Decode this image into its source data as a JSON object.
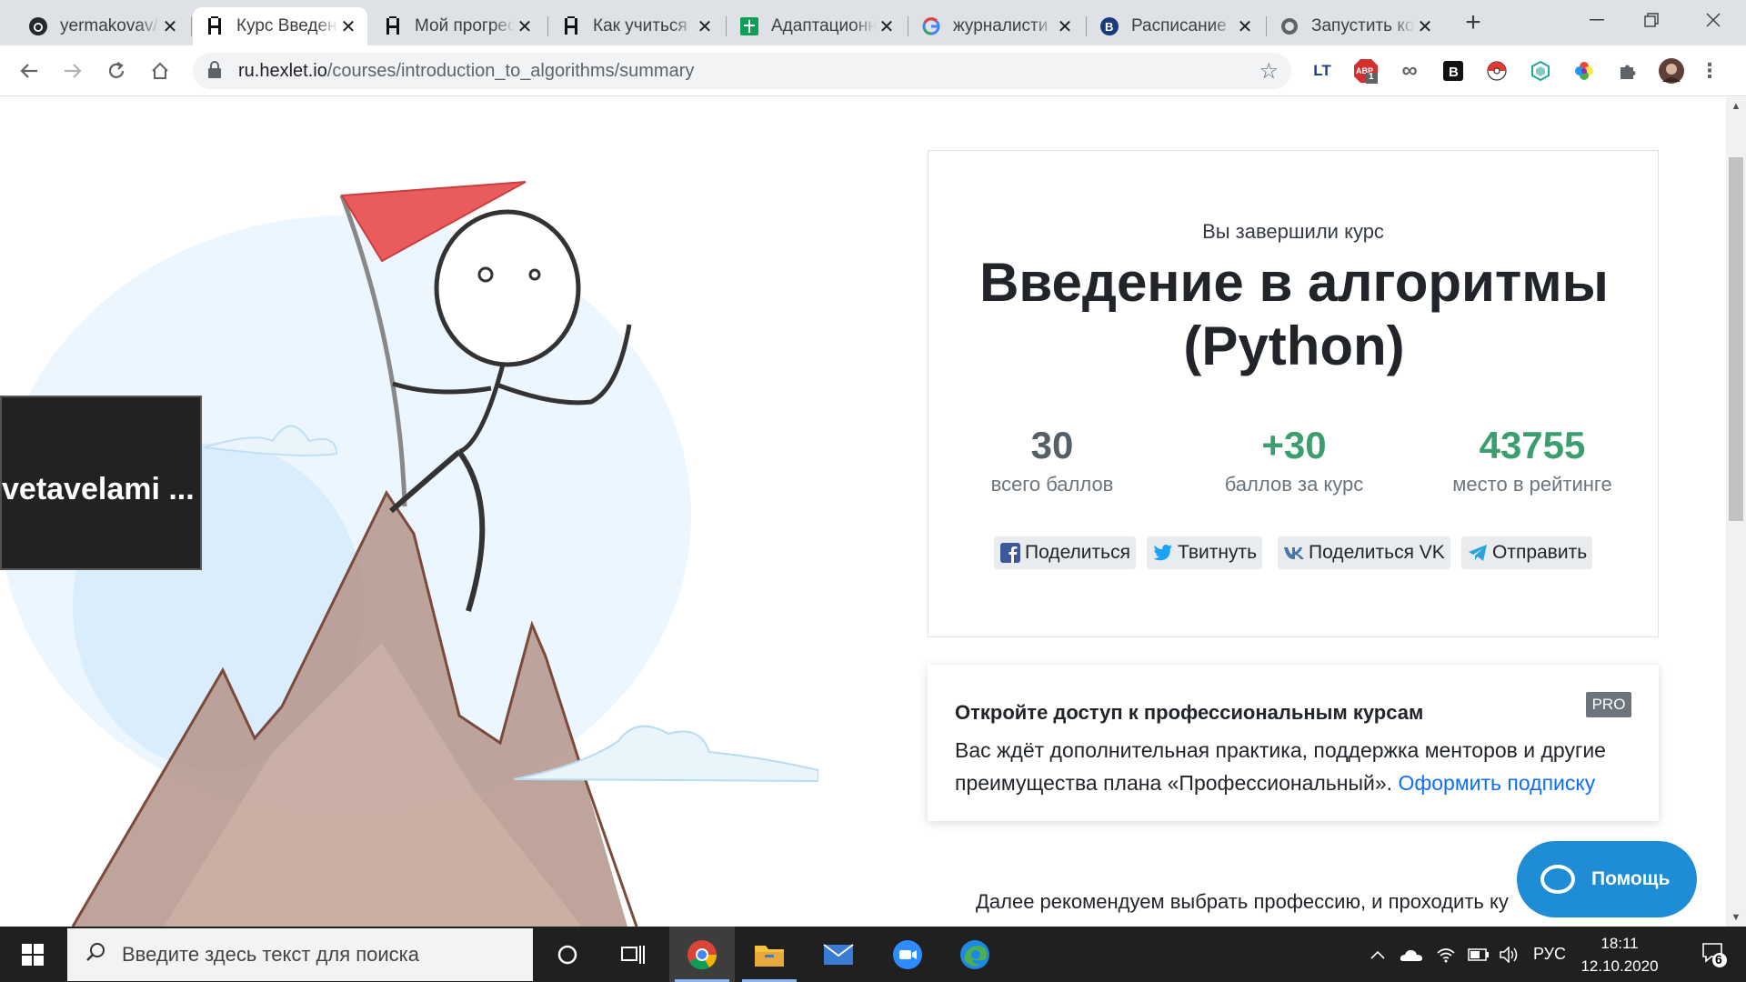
{
  "tabs": [
    {
      "title": "yermakovav/",
      "icon": "github-icon"
    },
    {
      "title": "Курс Введени",
      "icon": "hexlet-icon",
      "active": true
    },
    {
      "title": "Мой прогресс",
      "icon": "hexlet-icon"
    },
    {
      "title": "Как учиться",
      "icon": "hexlet-icon"
    },
    {
      "title": "Адаптационн",
      "icon": "sheets-icon"
    },
    {
      "title": "журналисти",
      "icon": "google-icon"
    },
    {
      "title": "Расписание",
      "icon": "hse-icon"
    },
    {
      "title": "Запустить ко",
      "icon": "globe-icon"
    }
  ],
  "toolbar": {
    "url_host": "ru.hexlet.io",
    "url_path": "/courses/introduction_to_algorithms/summary",
    "ext_adblock_count": "1"
  },
  "overlay": {
    "text": "vetavelami ..."
  },
  "summary": {
    "pretitle": "Вы завершили курс",
    "course_title": "Введение в алгоритмы (Python)",
    "stats": [
      {
        "value": "30",
        "label": "всего баллов",
        "color": "#555f66"
      },
      {
        "value": "+30",
        "label": "баллов за курс",
        "color": "#3a9e6e"
      },
      {
        "value": "43755",
        "label": "место в рейтинге",
        "color": "#3a9e6e"
      }
    ],
    "share": {
      "facebook": "Поделиться",
      "twitter": "Твитнуть",
      "vk": "Поделиться VK",
      "telegram": "Отправить"
    }
  },
  "pro": {
    "title": "Откройте доступ к профессиональным курсам",
    "badge": "PRO",
    "text": "Вас ждёт дополнительная практика, поддержка менторов и другие преимущества плана «Профессиональный».",
    "link": "Оформить подписку"
  },
  "next_text": "Далее рекомендуем выбрать профессию, и проходить ку",
  "help_label": "Помощь",
  "taskbar": {
    "search_placeholder": "Введите здесь текст для поиска",
    "lang": "РУС",
    "time": "18:11",
    "date": "12.10.2020",
    "notifications": "6"
  },
  "colors": {
    "accent_green": "#3a9e6e",
    "link_blue": "#0d6efd",
    "help_blue": "#1f8dd6"
  }
}
